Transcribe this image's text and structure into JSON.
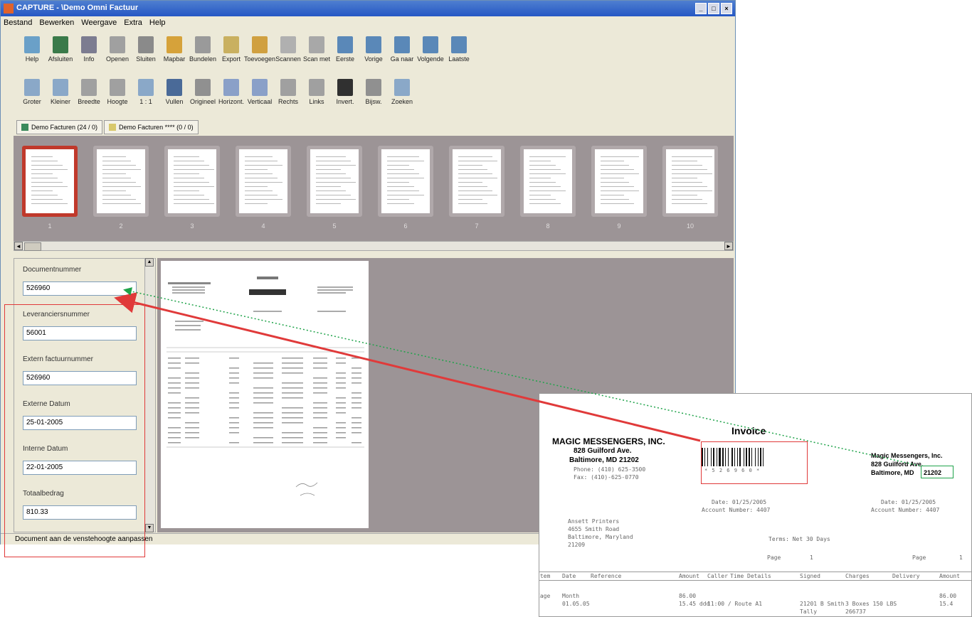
{
  "window": {
    "title": "CAPTURE - \\Demo Omni Factuur",
    "controls": [
      "_",
      "□",
      "×"
    ]
  },
  "menu": [
    "Bestand",
    "Bewerken",
    "Weergave",
    "Extra",
    "Help"
  ],
  "toolbar1": [
    {
      "label": "Help",
      "color": "#6aa0c8"
    },
    {
      "label": "Afsluiten",
      "color": "#3a7a4a"
    },
    {
      "label": "Info",
      "color": "#7c7c90"
    },
    {
      "label": "Openen",
      "color": "#a0a0a0"
    },
    {
      "label": "Sluiten",
      "color": "#8a8a8a"
    },
    {
      "label": "Mapbar",
      "color": "#d6a23a"
    },
    {
      "label": "Bundelen",
      "color": "#9a9a9a"
    },
    {
      "label": "Export",
      "color": "#c9b060"
    },
    {
      "label": "Toevoegen",
      "color": "#d0a040"
    },
    {
      "label": "Scannen",
      "color": "#b0b0b0"
    },
    {
      "label": "Scan met",
      "color": "#a8a8a8"
    },
    {
      "label": "Eerste",
      "color": "#5a88b8"
    },
    {
      "label": "Vorige",
      "color": "#5a88b8"
    },
    {
      "label": "Ga naar",
      "color": "#5a88b8"
    },
    {
      "label": "Volgende",
      "color": "#5a88b8"
    },
    {
      "label": "Laatste",
      "color": "#5a88b8"
    }
  ],
  "toolbar2": [
    {
      "label": "Groter",
      "color": "#8aa8c8"
    },
    {
      "label": "Kleiner",
      "color": "#8aa8c8"
    },
    {
      "label": "Breedte",
      "color": "#a0a0a0"
    },
    {
      "label": "Hoogte",
      "color": "#a0a0a0"
    },
    {
      "label": "1 : 1",
      "color": "#8aa8c8"
    },
    {
      "label": "Vullen",
      "color": "#4a6a98"
    },
    {
      "label": "Origineel",
      "color": "#909090"
    },
    {
      "label": "Horizont.",
      "color": "#8aa0c8"
    },
    {
      "label": "Verticaal",
      "color": "#8aa0c8"
    },
    {
      "label": "Rechts",
      "color": "#a0a0a0"
    },
    {
      "label": "Links",
      "color": "#a0a0a0"
    },
    {
      "label": "Invert.",
      "color": "#303030"
    },
    {
      "label": "Bijsw.",
      "color": "#909090"
    },
    {
      "label": "Zoeken",
      "color": "#8aa8c8"
    }
  ],
  "tabs": [
    {
      "label": "Demo Facturen (24 / 0)"
    },
    {
      "label": "Demo Facturen **** (0 / 0)"
    }
  ],
  "thumbnails": [
    "1",
    "2",
    "3",
    "4",
    "5",
    "6",
    "7",
    "8",
    "9",
    "10"
  ],
  "fields": [
    {
      "label": "Documentnummer",
      "value": "526960"
    },
    {
      "label": "Leveranciersnummer",
      "value": "56001"
    },
    {
      "label": "Extern factuurnummer",
      "value": "526960"
    },
    {
      "label": "Externe Datum",
      "value": "25-01-2005"
    },
    {
      "label": "Interne Datum",
      "value": "22-01-2005"
    },
    {
      "label": "Totaalbedrag",
      "value": "810.33"
    }
  ],
  "status": "Document aan de venstehoogte aanpassen",
  "invoice": {
    "title": "Invoice",
    "company": "MAGIC MESSENGERS, INC.",
    "address1": "828 Guilford Ave.",
    "address2": "Baltimore, MD 21202",
    "phone": "Phone: (410) 625-3500",
    "fax": "Fax:   (410)-625-0770",
    "barcode_text": "* 5 2 6 9 6 0 *",
    "recipient": "Magic Messengers, Inc.",
    "recipient_addr1": "828 Guilford Ave.",
    "recipient_city": "Baltimore, MD",
    "recipient_zip": "21202",
    "date_left": "Date:  01/25/2005",
    "account_left": "Account Number: 4407",
    "date_right": "Date:  01/25/2005",
    "account_right": "Account Number: 4407",
    "billto": [
      "Ansett Printers",
      "4655 Smith Road",
      "Baltimore, Maryland",
      "21209"
    ],
    "terms": "Terms: Net 30 Days",
    "page_left": "Page",
    "page_left_num": "1",
    "page_right": "Page",
    "page_right_num": "1",
    "columns": [
      "Item",
      "Date",
      "Reference",
      "Amount",
      "Caller",
      "Time",
      "Details",
      "Signed",
      "Charges",
      "Delivery",
      "Amount"
    ],
    "row1": [
      "Cage",
      "Month",
      "",
      "86.00",
      "",
      "",
      "",
      "",
      "",
      "",
      "86.00"
    ],
    "row2": [
      "",
      "01.05.05",
      "",
      "15.45 ddd",
      "11:00 / Route A1",
      "",
      "",
      "21201 B Smith",
      "3 Boxes 150 LBS",
      "",
      "15.4"
    ],
    "row3": [
      "",
      "",
      "",
      "",
      "",
      "",
      "",
      "Tally",
      "266737",
      "",
      ""
    ]
  }
}
